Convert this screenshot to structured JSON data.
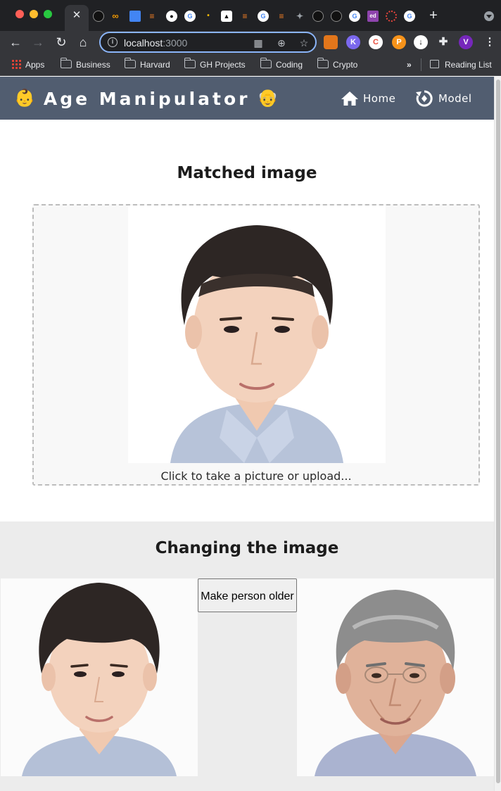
{
  "browser": {
    "tab_close_glyph": "✕",
    "new_tab_glyph": "+",
    "address": {
      "host": "localhost",
      "port": ":3000"
    },
    "bookmarks": [
      {
        "label": "Apps",
        "icon": "apps-grid-icon"
      },
      {
        "label": "Business",
        "icon": "folder-icon"
      },
      {
        "label": "Harvard",
        "icon": "folder-icon"
      },
      {
        "label": "GH Projects",
        "icon": "folder-icon"
      },
      {
        "label": "Coding",
        "icon": "folder-icon"
      },
      {
        "label": "Crypto",
        "icon": "folder-icon"
      }
    ],
    "overflow_label": "»",
    "reading_list_label": "Reading List",
    "profile_initial": "V",
    "ext_letters": {
      "k": "K",
      "ed": "ed"
    }
  },
  "app": {
    "title": "Age Manipulator",
    "title_emoji_left": "👶",
    "title_emoji_right": "👴",
    "nav": [
      {
        "label": "Home",
        "icon": "home-icon"
      },
      {
        "label": "Model",
        "icon": "model-cycle-icon"
      }
    ]
  },
  "matched": {
    "heading": "Matched image",
    "upload_hint": "Click to take a picture or upload..."
  },
  "changing": {
    "heading": "Changing the image",
    "button_label": "Make person older"
  },
  "colors": {
    "header_bg": "#515d70",
    "address_ring": "#8ab4f8",
    "band_bg": "#ececec"
  }
}
